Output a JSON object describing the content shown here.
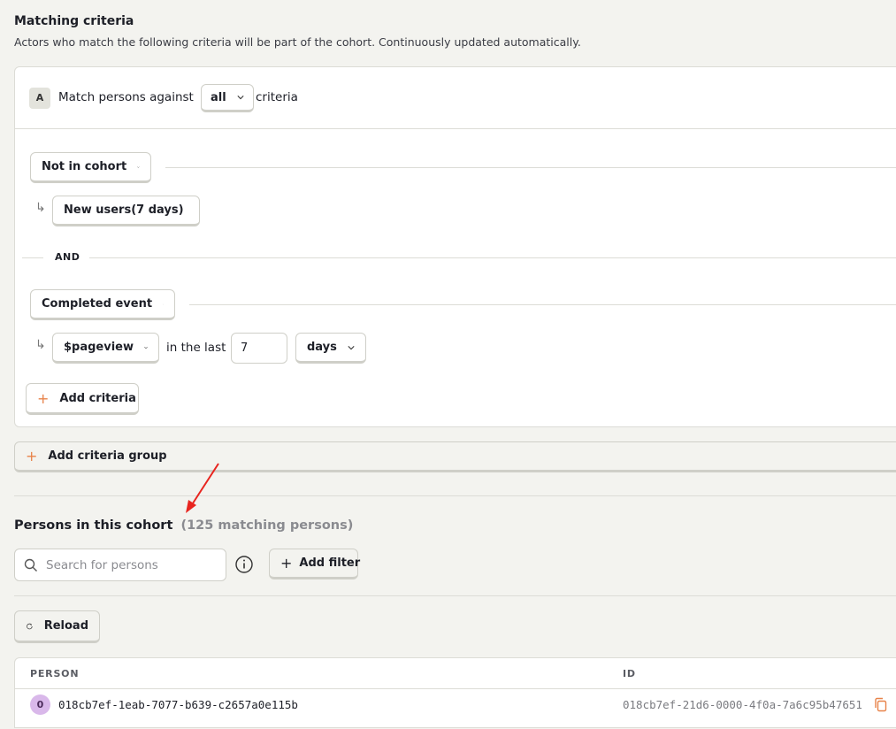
{
  "matching": {
    "title": "Matching criteria",
    "description": "Actors who match the following criteria will be part of the cohort. Continuously updated automatically."
  },
  "group": {
    "badge": "A",
    "match_prefix": "Match persons against",
    "match_value": "all",
    "match_suffix": "criteria"
  },
  "criteria": [
    {
      "type": "Not in cohort",
      "sub_value": "New users(7 days)"
    },
    {
      "type": "Completed event",
      "event": "$pageview",
      "in_the_last": "in the last",
      "amount": "7",
      "unit": "days"
    }
  ],
  "and_label": "AND",
  "add_criteria_label": "Add criteria",
  "add_group_label": "Add criteria group",
  "persons": {
    "title": "Persons in this cohort",
    "count": "(125 matching persons)",
    "search_placeholder": "Search for persons",
    "add_filter_label": "Add filter",
    "reload_label": "Reload",
    "columns": [
      "PERSON",
      "ID"
    ],
    "rows": [
      {
        "avatar": "0",
        "person": "018cb7ef-1eab-7077-b639-c2657a0e115b",
        "id": "018cb7ef-21d6-0000-4f0a-7a6c95b47651"
      }
    ]
  },
  "colors": {
    "accent_plus": "#e8834a",
    "annotation_arrow": "#e8251f",
    "avatar_bg": "#d9b8ea"
  }
}
